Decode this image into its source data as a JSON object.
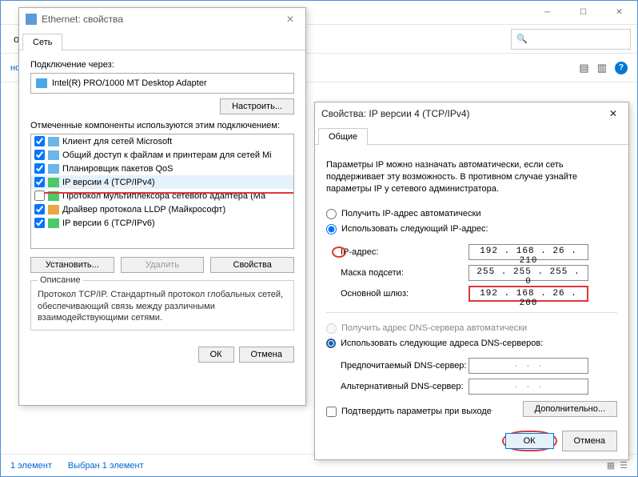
{
  "main": {
    "toolbar_label": "очения",
    "search_placeholder": "",
    "sub_link": "ностика подключения",
    "chevron": "»"
  },
  "status": {
    "count": "1 элемент",
    "selected": "Выбран 1 элемент"
  },
  "dlg1": {
    "title": "Ethernet: свойства",
    "tab": "Сеть",
    "connect_via": "Подключение через:",
    "adapter": "Intel(R) PRO/1000 MT Desktop Adapter",
    "configure": "Настроить...",
    "components_label": "Отмеченные компоненты используются этим подключением:",
    "components": [
      {
        "checked": true,
        "cls": "svc",
        "label": "Клиент для сетей Microsoft"
      },
      {
        "checked": true,
        "cls": "svc",
        "label": "Общий доступ к файлам и принтерам для сетей Mi"
      },
      {
        "checked": true,
        "cls": "svc",
        "label": "Планировщик пакетов QoS"
      },
      {
        "checked": true,
        "cls": "net",
        "label": "IP версии 4 (TCP/IPv4)"
      },
      {
        "checked": false,
        "cls": "net",
        "label": "Протокол мультиплексора сетевого адаптера (Ма"
      },
      {
        "checked": true,
        "cls": "drv",
        "label": "Драйвер протокола LLDP (Майкрософт)"
      },
      {
        "checked": true,
        "cls": "net",
        "label": "IP версии 6 (TCP/IPv6)"
      }
    ],
    "install": "Установить...",
    "uninstall": "Удалить",
    "properties": "Свойства",
    "desc_title": "Описание",
    "desc_text": "Протокол TCP/IP. Стандартный протокол глобальных сетей, обеспечивающий связь между различными взаимодействующими сетями.",
    "ok": "ОК",
    "cancel": "Отмена"
  },
  "dlg2": {
    "title": "Свойства: IP версии 4 (TCP/IPv4)",
    "tab": "Общие",
    "info": "Параметры IP можно назначать автоматически, если сеть поддерживает эту возможность. В противном случае узнайте параметры IP у сетевого администратора.",
    "radio_auto_ip": "Получить IP-адрес автоматически",
    "radio_manual_ip": "Использовать следующий IP-адрес:",
    "lbl_ip": "IP-адрес:",
    "val_ip": "192 . 168 .  26 . 210",
    "lbl_mask": "Маска подсети:",
    "val_mask": "255 . 255 . 255 .  0",
    "lbl_gw": "Основной шлюз:",
    "val_gw": "192 . 168 .  26 . 200",
    "radio_auto_dns": "Получить адрес DNS-сервера автоматически",
    "radio_manual_dns": "Использовать следующие адреса DNS-серверов:",
    "lbl_dns1": "Предпочитаемый DNS-сервер:",
    "val_dns1": ".       .       .",
    "lbl_dns2": "Альтернативный DNS-сервер:",
    "val_dns2": ".       .       .",
    "confirm": "Подтвердить параметры при выходе",
    "advanced": "Дополнительно...",
    "ok": "ОК",
    "cancel": "Отмена"
  }
}
